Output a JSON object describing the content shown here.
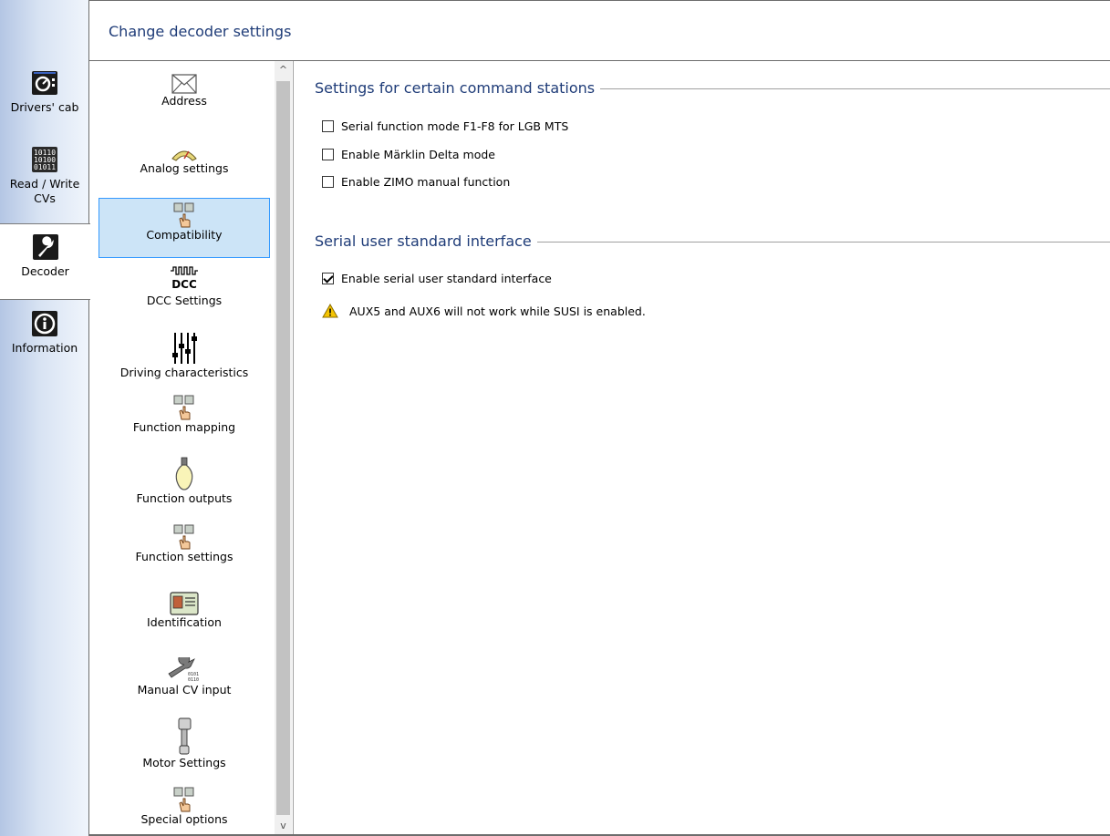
{
  "rail": {
    "tabs": [
      {
        "label": "Drivers' cab",
        "icon": "speedometer-icon"
      },
      {
        "label": "Read / Write CVs",
        "label_line1": "Read / Write",
        "label_line2": "CVs",
        "icon": "binary-data-icon"
      },
      {
        "label": "Decoder",
        "icon": "wrench-icon",
        "active": true
      },
      {
        "label": "Information",
        "icon": "info-icon"
      }
    ]
  },
  "header": {
    "title": "Change decoder settings"
  },
  "categories": {
    "items": [
      {
        "label": "Address",
        "icon": "envelope-icon"
      },
      {
        "label": "Analog settings",
        "icon": "analog-gauge-icon"
      },
      {
        "label": "Compatibility",
        "icon": "function-keys-hand-icon",
        "selected": true
      },
      {
        "label": "DCC Settings",
        "icon": "dcc-signal-icon"
      },
      {
        "label": "Driving characteristics",
        "icon": "sliders-icon"
      },
      {
        "label": "Function mapping",
        "icon": "function-keys-hand-icon"
      },
      {
        "label": "Function outputs",
        "icon": "light-bulb-icon"
      },
      {
        "label": "Function settings",
        "icon": "function-keys-hand-icon"
      },
      {
        "label": "Identification",
        "icon": "id-card-icon"
      },
      {
        "label": "Manual CV input",
        "icon": "wrench-binary-icon"
      },
      {
        "label": "Motor Settings",
        "icon": "motor-icon"
      },
      {
        "label": "Special options",
        "icon": "function-keys-hand-icon"
      }
    ],
    "scroll_up": "^",
    "scroll_down": "v"
  },
  "content": {
    "group1": {
      "title": "Settings for certain command stations",
      "options": [
        {
          "label": "Serial function mode F1-F8 for LGB MTS",
          "checked": false
        },
        {
          "label": "Enable Märklin Delta mode",
          "checked": false
        },
        {
          "label": "Enable ZIMO manual function",
          "checked": false
        }
      ]
    },
    "group2": {
      "title": "Serial user standard interface",
      "options": [
        {
          "label": "Enable serial user standard interface",
          "checked": true
        }
      ],
      "warning": "AUX5 and AUX6 will not work while SUSI is enabled."
    }
  },
  "colors": {
    "heading": "#1f3c78",
    "selection_bg": "#cce4f7",
    "selection_border": "#3399ff",
    "warning": "#f5c400"
  }
}
